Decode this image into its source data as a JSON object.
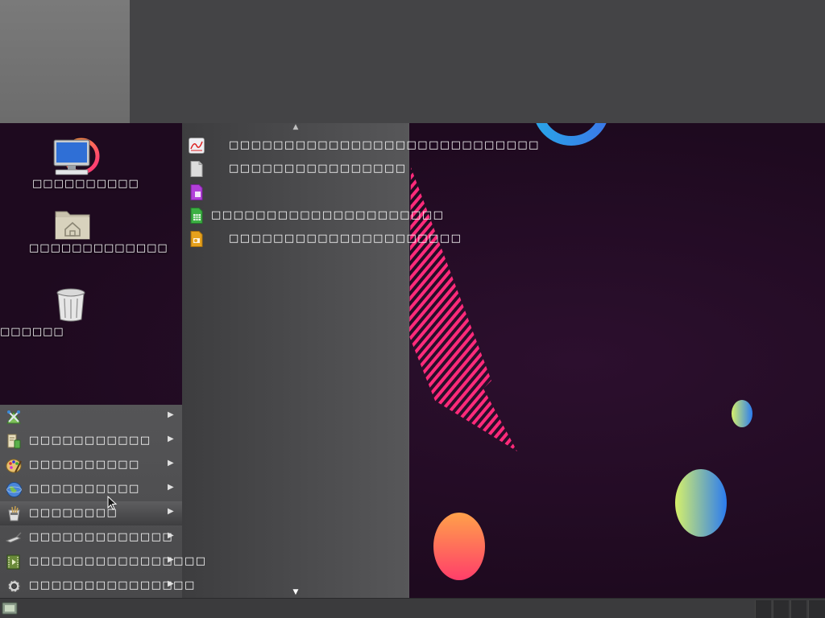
{
  "desktop": {
    "icons": [
      {
        "name": "computer",
        "label": "□□□□□□□□□□"
      },
      {
        "name": "home-folder",
        "label": "□□□□□□□□□□□□□"
      },
      {
        "name": "trash",
        "label": "□□□□□□"
      }
    ]
  },
  "submenu": {
    "items": [
      {
        "icon": "pdf-viewer-icon",
        "label": "□□□□□□□□□□□□□□□□□□□□□□□□□□□□",
        "color": "#e8e8ee"
      },
      {
        "icon": "document-icon",
        "label": "□□□□□□□□□□□□□□□□",
        "color": "#d9d9d9"
      },
      {
        "icon": "office-math-icon",
        "label": "",
        "color": "#b23fd9"
      },
      {
        "icon": "spreadsheet-icon",
        "label": "□□□□□□□□□□□□□□□□□□□□□",
        "color": "#3cb043"
      },
      {
        "icon": "presentation-icon",
        "label": "□□□□□□□□□□□□□□□□□□□□□",
        "color": "#e6a11c"
      }
    ]
  },
  "menu": {
    "items": [
      {
        "icon": "accessories-icon",
        "label": "",
        "active": false
      },
      {
        "icon": "education-icon",
        "label": "□□□□□□□□□□□",
        "active": false
      },
      {
        "icon": "graphics-icon",
        "label": "□□□□□□□□□□",
        "active": false
      },
      {
        "icon": "internet-icon",
        "label": "□□□□□□□□□□",
        "active": false
      },
      {
        "icon": "office-icon",
        "label": "□□□□□□□□",
        "active": true
      },
      {
        "icon": "programming-icon",
        "label": "□□□□□□□□□□□□□",
        "active": false
      },
      {
        "icon": "multimedia-icon",
        "label": "□□□□□□□□□□□□□□□□",
        "active": false
      },
      {
        "icon": "system-settings-icon",
        "label": "□□□□□□□□□□□□□□□",
        "active": false
      }
    ]
  },
  "taskbar": {
    "start_icon": "start-menu-icon"
  }
}
